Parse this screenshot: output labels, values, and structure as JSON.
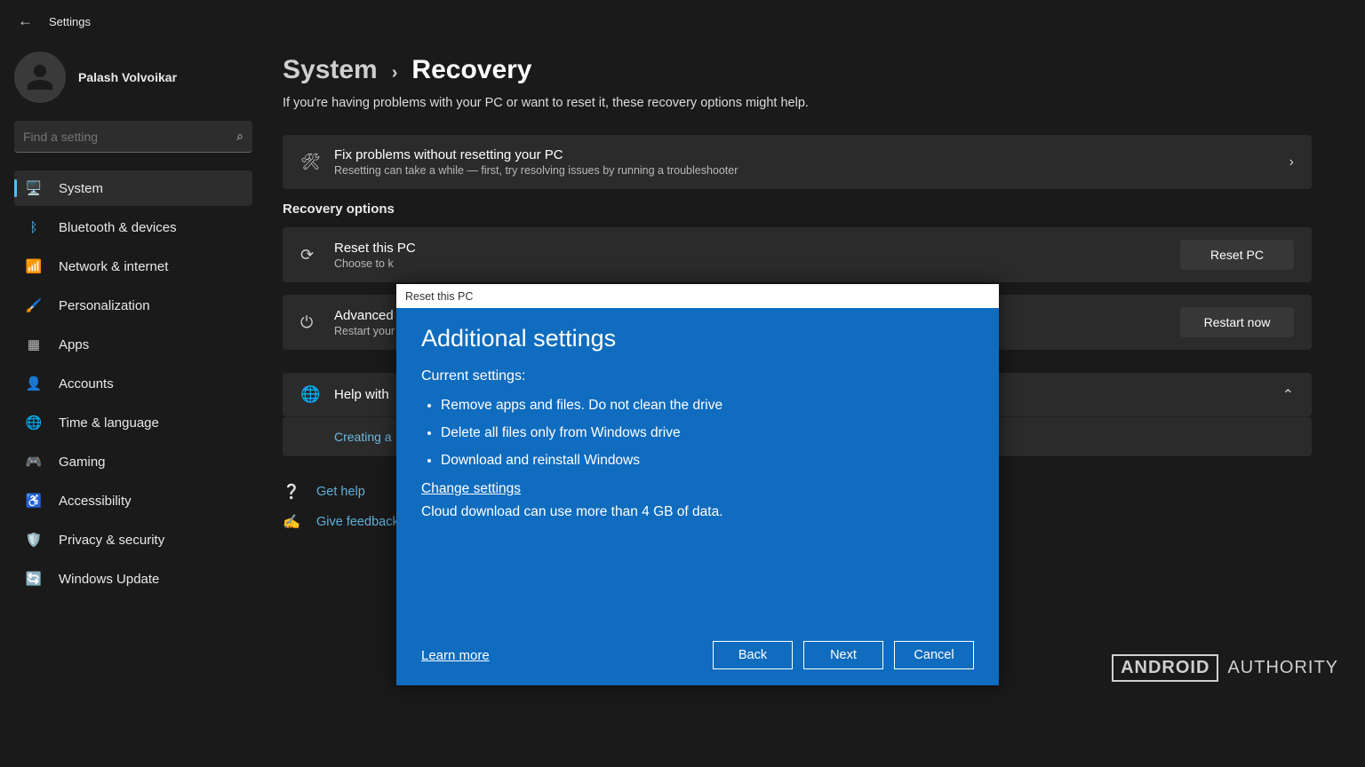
{
  "app": {
    "title": "Settings"
  },
  "profile": {
    "name": "Palash Volvoikar"
  },
  "search": {
    "placeholder": "Find a setting"
  },
  "sidebar": {
    "items": [
      {
        "label": "System",
        "icon": "🖥️",
        "active": true,
        "color": "#4cc2ff"
      },
      {
        "label": "Bluetooth & devices",
        "icon": "ᛒ",
        "active": false,
        "color": "#4cc2ff"
      },
      {
        "label": "Network & internet",
        "icon": "📶",
        "active": false,
        "color": "#4cc2ff"
      },
      {
        "label": "Personalization",
        "icon": "🖌️",
        "active": false,
        "color": "#bdbdbd"
      },
      {
        "label": "Apps",
        "icon": "▦",
        "active": false,
        "color": "#bdbdbd"
      },
      {
        "label": "Accounts",
        "icon": "👤",
        "active": false,
        "color": "#3fbf8e"
      },
      {
        "label": "Time & language",
        "icon": "🌐",
        "active": false,
        "color": "#4cc2ff"
      },
      {
        "label": "Gaming",
        "icon": "🎮",
        "active": false,
        "color": "#bdbdbd"
      },
      {
        "label": "Accessibility",
        "icon": "♿",
        "active": false,
        "color": "#4cc2ff"
      },
      {
        "label": "Privacy & security",
        "icon": "🛡️",
        "active": false,
        "color": "#bdbdbd"
      },
      {
        "label": "Windows Update",
        "icon": "🔄",
        "active": false,
        "color": "#4cc2ff"
      }
    ]
  },
  "breadcrumb": {
    "root": "System",
    "current": "Recovery"
  },
  "page": {
    "subtitle": "If you're having problems with your PC or want to reset it, these recovery options might help.",
    "troubleshoot": {
      "title": "Fix problems without resetting your PC",
      "subtitle": "Resetting can take a while — first, try resolving issues by running a troubleshooter"
    },
    "recovery_heading": "Recovery options",
    "reset": {
      "title": "Reset this PC",
      "subtitle": "Choose to k",
      "button": "Reset PC"
    },
    "advanced": {
      "title": "Advanced",
      "subtitle": "Restart your",
      "button": "Restart now"
    },
    "help": {
      "title": "Help with"
    },
    "creating": "Creating a",
    "get_help": "Get help",
    "give_feedback": "Give feedback"
  },
  "modal": {
    "title": "Reset this PC",
    "heading": "Additional settings",
    "current_label": "Current settings:",
    "bullets": [
      "Remove apps and files. Do not clean the drive",
      "Delete all files only from Windows drive",
      "Download and reinstall Windows"
    ],
    "change_link": "Change settings",
    "note": "Cloud download can use more than 4 GB of data.",
    "learn_more": "Learn more",
    "back": "Back",
    "next": "Next",
    "cancel": "Cancel"
  },
  "watermark": {
    "brand": "ANDROID",
    "suffix": "AUTHORITY"
  }
}
